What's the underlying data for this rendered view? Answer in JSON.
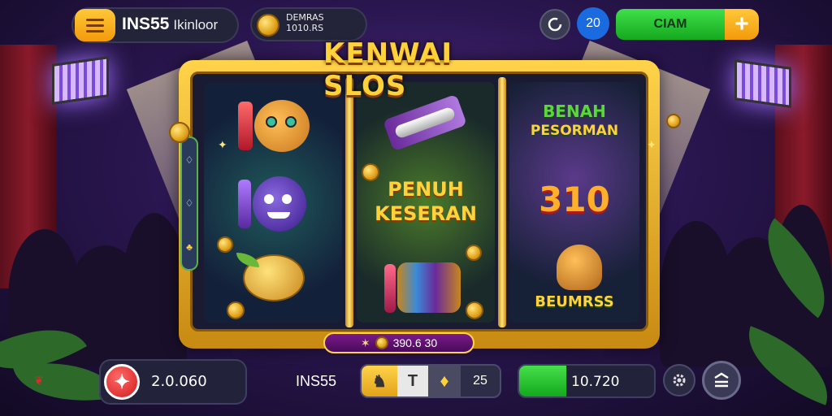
{
  "header": {
    "brand": "INS55",
    "brand_sub": "Ikinloor",
    "balance_line1": "DEMRAS",
    "balance_line2": "1010.RS",
    "level": "20",
    "claim_label": "CIAM",
    "plus_label": "+"
  },
  "machine": {
    "title": "KENWAI SLOS",
    "reel1": {
      "symbols": [
        "bear-10-icon",
        "purple-10-icon",
        "gold-fruit-icon"
      ]
    },
    "reel2": {
      "symbols": [
        "scroll-icon",
        "drum-icon"
      ],
      "text_line1": "PENUH",
      "text_line2": "KESERAN"
    },
    "reel3": {
      "text_line1": "BENAH",
      "text_line2": "PESORMAN",
      "number": "310",
      "bottom_text": "BEUMRSS",
      "symbols": [
        "monkey-icon"
      ]
    },
    "side_strip": [
      "♢",
      "♢",
      "♣"
    ],
    "bet_value": "390.6 30"
  },
  "footer": {
    "balance": "2.0.060",
    "brand": "INS55",
    "ctrl_a": "♞",
    "ctrl_b": "T",
    "ctrl_c": "♦",
    "ctrl_value": "25",
    "win_value": "10.720",
    "win_fill_pct": 35
  },
  "colors": {
    "accent_gold": "#ffc838",
    "claim_green": "#14a81e",
    "spin_red": "#d21a1a",
    "level_blue": "#1a6ae0"
  }
}
